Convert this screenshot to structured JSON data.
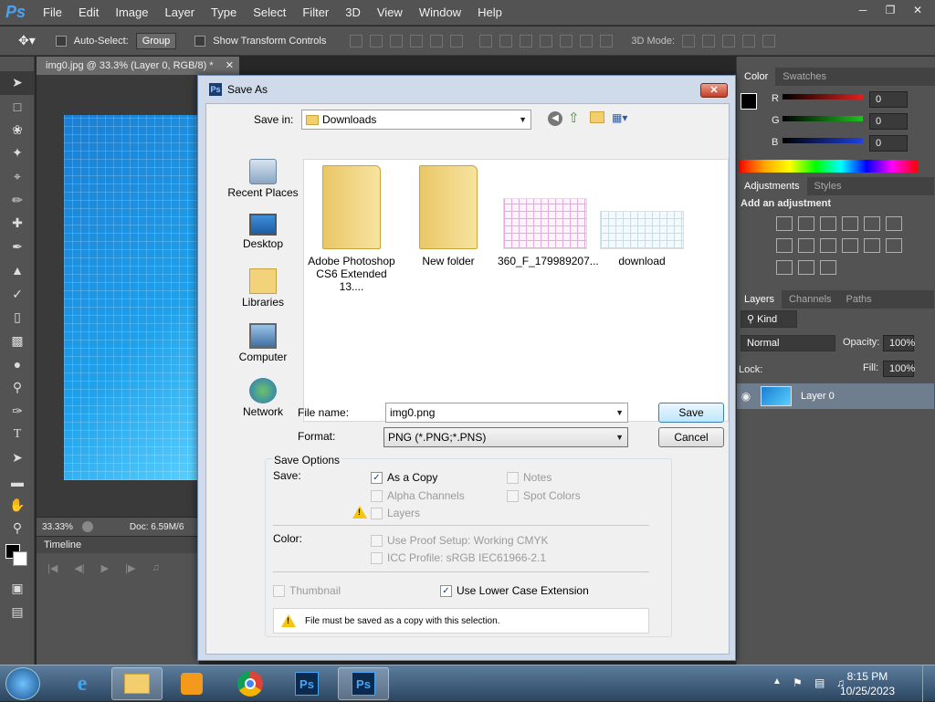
{
  "app": {
    "logo": "Ps"
  },
  "menu": [
    "File",
    "Edit",
    "Image",
    "Layer",
    "Type",
    "Select",
    "Filter",
    "3D",
    "View",
    "Window",
    "Help"
  ],
  "options": {
    "auto_select_label": "Auto-Select:",
    "auto_select_value": "Group",
    "transform_label": "Show Transform Controls",
    "mode_3d": "3D Mode:"
  },
  "document": {
    "tab_title": "img0.jpg @ 33.3% (Layer 0, RGB/8) *",
    "zoom": "33.33%",
    "doc_info": "Doc: 6.59M/6",
    "timeline_label": "Timeline"
  },
  "panels": {
    "color_tabs": [
      "Color",
      "Swatches"
    ],
    "channels": [
      {
        "name": "R",
        "value": "0",
        "color": "#e02020"
      },
      {
        "name": "G",
        "value": "0",
        "color": "#20c020"
      },
      {
        "name": "B",
        "value": "0",
        "color": "#2040e0"
      }
    ],
    "adj_tabs": [
      "Adjustments",
      "Styles"
    ],
    "adj_title": "Add an adjustment",
    "layer_tabs": [
      "Layers",
      "Channels",
      "Paths"
    ],
    "kind_label": "Kind",
    "blend_mode": "Normal",
    "opacity_label": "Opacity:",
    "opacity_value": "100%",
    "lock_label": "Lock:",
    "fill_label": "Fill:",
    "fill_value": "100%",
    "layer_name": "Layer 0"
  },
  "dialog": {
    "title": "Save As",
    "save_in_label": "Save in:",
    "save_in_value": "Downloads",
    "places": [
      "Recent Places",
      "Desktop",
      "Libraries",
      "Computer",
      "Network"
    ],
    "files": [
      {
        "name": "Adobe Photoshop CS6 Extended 13...."
      },
      {
        "name": "New folder"
      },
      {
        "name": "360_F_179989207..."
      },
      {
        "name": "download"
      }
    ],
    "file_name_label": "File name:",
    "file_name_value": "img0.png",
    "format_label": "Format:",
    "format_value": "PNG (*.PNG;*.PNS)",
    "save_button": "Save",
    "cancel_button": "Cancel",
    "save_options_title": "Save Options",
    "save_label": "Save:",
    "opts": {
      "as_copy": "As a Copy",
      "alpha": "Alpha Channels",
      "layers": "Layers",
      "notes": "Notes",
      "spot": "Spot Colors"
    },
    "color_label": "Color:",
    "proof_label": "Use Proof Setup:  Working CMYK",
    "icc_label": "ICC Profile:  sRGB IEC61966-2.1",
    "thumbnail_label": "Thumbnail",
    "lowercase_label": "Use Lower Case Extension",
    "warning": "File must be saved as a copy with this selection."
  },
  "taskbar": {
    "time": "8:15 PM",
    "date": "10/25/2023"
  }
}
